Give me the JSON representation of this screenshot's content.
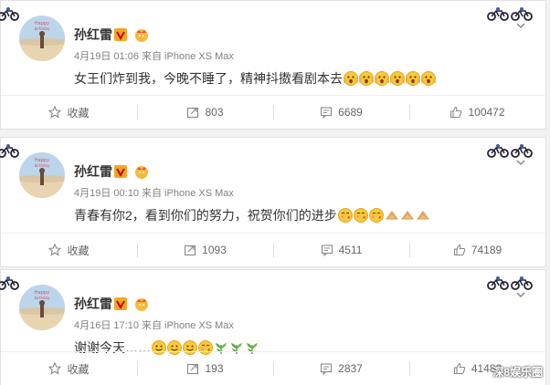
{
  "posts": [
    {
      "name": "孙红雷",
      "time": "4月19日 01:06",
      "source": "来自 iPhone XS Max",
      "content": "女王们炸到我，今晚不睡了，精神抖擞看剧本去",
      "emojis": [
        "shocked",
        "shocked",
        "shocked",
        "shocked",
        "shocked",
        "shocked"
      ],
      "actions": {
        "fav": "收藏",
        "repost": "803",
        "comment": "6689",
        "like": "100472"
      }
    },
    {
      "name": "孙红雷",
      "time": "4月19日 00:10",
      "source": "来自 iPhone XS Max",
      "content": "青春有你2，看到你们的努力，祝贺你们的进步",
      "emojis": [
        "kiss",
        "kiss",
        "kiss",
        "clap",
        "clap",
        "clap"
      ],
      "actions": {
        "fav": "收藏",
        "repost": "1093",
        "comment": "4511",
        "like": "74189"
      }
    },
    {
      "name": "孙红雷",
      "time": "4月16日 17:10",
      "source": "来自 iPhone XS Max",
      "content": "谢谢今天……",
      "emojis": [
        "smile",
        "smile",
        "smile",
        "kiss",
        "leaf",
        "leaf",
        "leaf"
      ],
      "actions": {
        "fav": "收藏",
        "repost": "193",
        "comment": "2837",
        "like": "41482"
      }
    }
  ],
  "watermark": "深8娱乐圈",
  "icons": {
    "fav": "star-icon",
    "repost": "share-icon",
    "comment": "comment-icon",
    "like": "thumbs-up-icon"
  }
}
